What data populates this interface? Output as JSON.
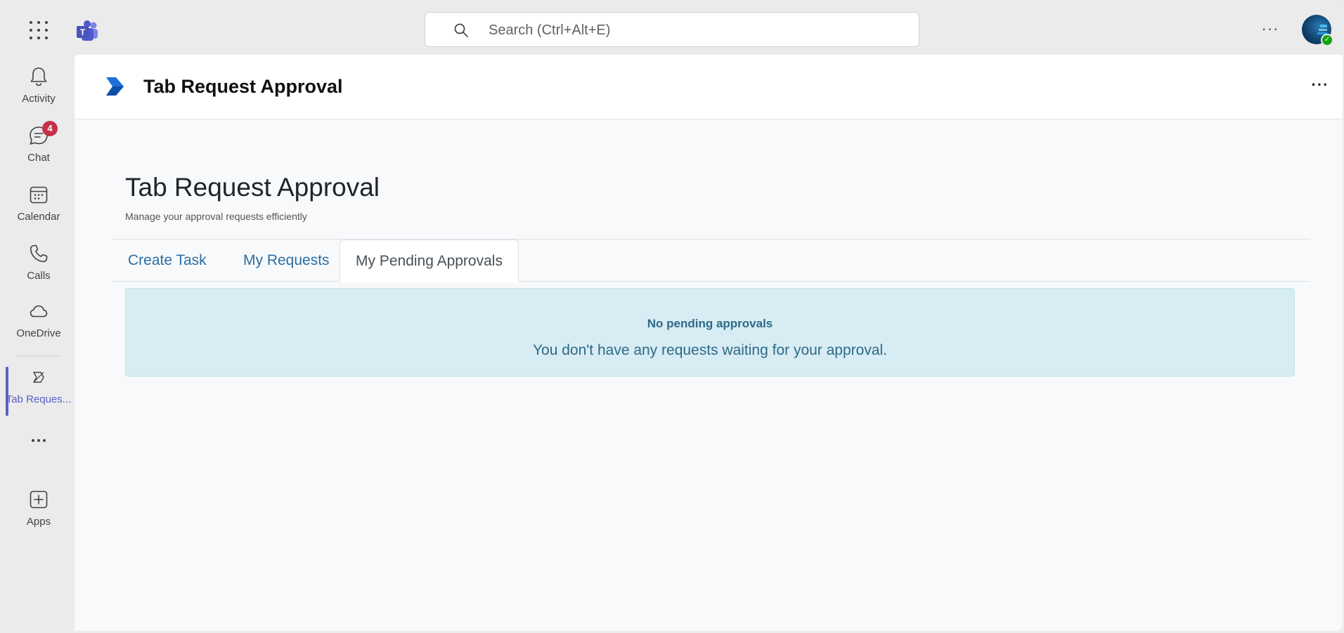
{
  "topbar": {
    "search_placeholder": "Search (Ctrl+Alt+E)"
  },
  "rail": {
    "items": [
      {
        "label": "Activity",
        "icon": "bell-icon"
      },
      {
        "label": "Chat",
        "icon": "chat-icon",
        "badge": "4"
      },
      {
        "label": "Calendar",
        "icon": "calendar-icon"
      },
      {
        "label": "Calls",
        "icon": "phone-icon"
      },
      {
        "label": "OneDrive",
        "icon": "cloud-icon"
      },
      {
        "label": "Tab Reques...",
        "icon": "app-icon",
        "active": true
      },
      {
        "label": "Apps",
        "icon": "add-app-icon"
      }
    ]
  },
  "app": {
    "header_title": "Tab Request Approval",
    "page_title": "Tab Request Approval",
    "page_subtitle": "Manage your approval requests efficiently",
    "tabs": [
      {
        "label": "Create Task",
        "active": false
      },
      {
        "label": "My Requests",
        "active": false
      },
      {
        "label": "My Pending Approvals",
        "active": true
      }
    ],
    "alert": {
      "title": "No pending approvals",
      "text": "You don't have any requests waiting for your approval."
    }
  },
  "colors": {
    "accent": "#5b5fc7",
    "badge": "#c4314b",
    "link": "#2a6ea6",
    "alert_bg": "#d8ecf4",
    "alert_text": "#2d6a87"
  }
}
